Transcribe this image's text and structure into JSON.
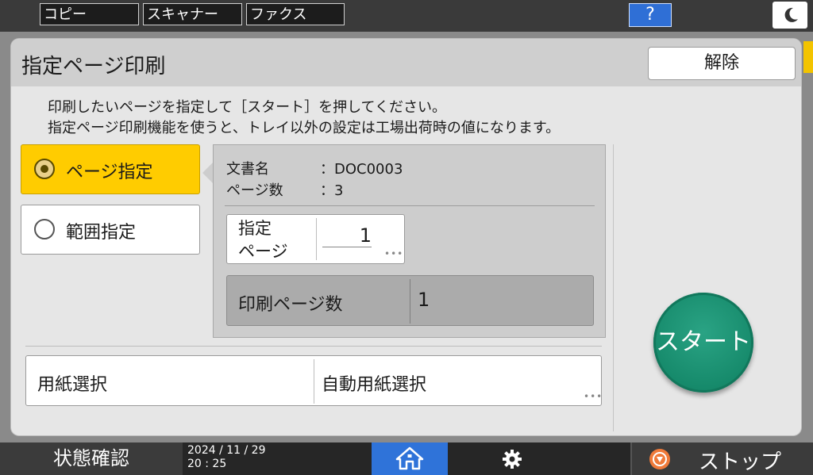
{
  "topbar": {
    "tabs": [
      "コピー",
      "スキャナー",
      "ファクス"
    ],
    "help_label": "?"
  },
  "dialog": {
    "title": "指定ページ印刷",
    "release_label": "解除",
    "instructions": [
      "印刷したいページを指定して［スタート］を押してください。",
      "指定ページ印刷機能を使うと、トレイ以外の設定は工場出荷時の値になります。"
    ],
    "options": [
      {
        "label": "ページ指定",
        "selected": true
      },
      {
        "label": "範囲指定",
        "selected": false
      }
    ],
    "doc_info": {
      "name_label": "文書名",
      "name_value": "：DOC0003",
      "pages_label": "ページ数",
      "pages_value": "：3"
    },
    "spec_page": {
      "label_line1": "指定",
      "label_line2": "ページ",
      "value": "1"
    },
    "print_count": {
      "label": "印刷ページ数",
      "value": "1"
    },
    "paper": {
      "label": "用紙選択",
      "value": "自動用紙選択"
    },
    "start_label": "スタート"
  },
  "bottombar": {
    "status_label": "状態確認",
    "date": "2024 / 11 / 29",
    "time": "20 : 25",
    "stop_label": "ストップ"
  },
  "colors": {
    "selected_option": "#ffcc00",
    "start_button": "#168a6b",
    "home_button": "#2f73d9",
    "stop_icon": "#f07a3a"
  }
}
